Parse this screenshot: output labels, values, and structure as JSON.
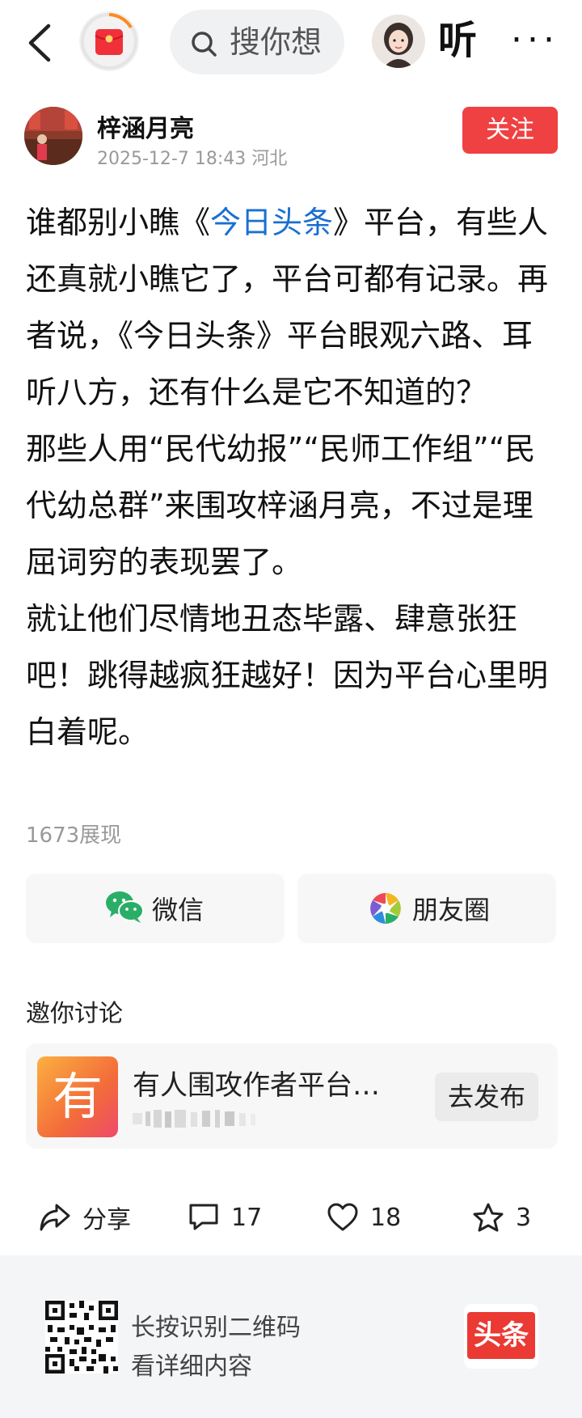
{
  "header": {
    "search_placeholder": "搜你想",
    "listen_label": "听",
    "more_label": "···"
  },
  "author": {
    "name": "梓涵月亮",
    "meta": "2025-12-7 18:43  河北",
    "follow_label": "关注"
  },
  "post": {
    "p1_before": "谁都别小瞧《",
    "p1_link": "今日头条",
    "p1_after": "》平台，有些人还真就小瞧它了，平台可都有记录。再者说，《今日头条》平台眼观六路、耳听八方，还有什么是它不知道的？",
    "p2": "那些人用“民代幼报”“民师工作组”“民代幼总群”来围攻梓涵月亮，不过是理屈词穷的表现罢了。",
    "p3": "就让他们尽情地丑态毕露、肆意张狂吧！跳得越疯狂越好！因为平台心里明白着呢。",
    "views": "1673展现"
  },
  "share": {
    "wechat_label": "微信",
    "moments_label": "朋友圈"
  },
  "invite": {
    "title": "邀你讨论",
    "topic_badge": "有",
    "topic_title": "有人围攻作者平台…",
    "publish_label": "去发布"
  },
  "actions": {
    "share_label": "分享",
    "comments": "17",
    "likes": "18",
    "favorites": "3"
  },
  "footer": {
    "line1": "长按识别二维码",
    "line2": "看详细内容",
    "logo_text": "头条"
  },
  "colors": {
    "accent_red": "#f04142",
    "link_blue": "#1a6fd1"
  }
}
